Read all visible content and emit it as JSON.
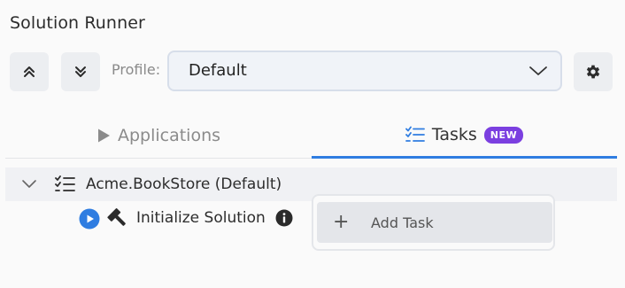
{
  "header": {
    "title": "Solution Runner"
  },
  "toolbar": {
    "expand_all_icon": "chevrons-up-icon",
    "collapse_all_icon": "chevrons-down-icon",
    "profile_label": "Profile:",
    "profile_value": "Default",
    "settings_icon": "gear-icon"
  },
  "tabs": [
    {
      "label": "Applications",
      "icon": "play-triangle-icon",
      "active": false
    },
    {
      "label": "Tasks",
      "icon": "checklist-icon",
      "badge": "NEW",
      "active": true
    }
  ],
  "tree": {
    "root_label": "Acme.BookStore (Default)",
    "children": [
      {
        "label": "Initialize Solution",
        "icon": "hammer-icon"
      }
    ]
  },
  "context_menu": {
    "items": [
      {
        "label": "Add Task",
        "icon": "plus-icon"
      }
    ]
  },
  "colors": {
    "accent": "#2f7de1",
    "badge": "#7b3fe0",
    "background": "#fafafa"
  }
}
